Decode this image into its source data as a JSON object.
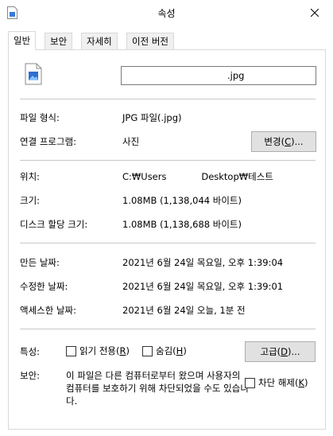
{
  "window": {
    "title": "속성"
  },
  "tabs": [
    {
      "label": "일반"
    },
    {
      "label": "보안"
    },
    {
      "label": "자세히"
    },
    {
      "label": "이전 버전"
    }
  ],
  "file": {
    "name": ".jpg"
  },
  "general": {
    "file_type_label": "파일 형식:",
    "file_type_value": "JPG 파일(.jpg)",
    "opens_with_label": "연결 프로그램:",
    "opens_with_value": "사진",
    "change_button": "변경(",
    "change_button_key": "C",
    "change_button_tail": ")...",
    "location_label": "위치:",
    "location_value": "C:₩Users            Desktop₩테스트",
    "size_label": "크기:",
    "size_value": "1.08MB (1,138,044 바이트)",
    "disk_size_label": "디스크 할당 크기:",
    "disk_size_value": "1.08MB (1,138,688 바이트)",
    "created_label": "만든 날짜:",
    "created_value": "2021년 6월 24일 목요일, 오후 1:39:04",
    "modified_label": "수정한 날짜:",
    "modified_value": "2021년 6월 24일 목요일, 오후 1:39:01",
    "accessed_label": "액세스한 날짜:",
    "accessed_value": "2021년 6월 24일 오늘, 1분 전"
  },
  "attributes": {
    "label": "특성:",
    "readonly": "읽기 전용(",
    "readonly_key": "R",
    "readonly_tail": ")",
    "hidden": "숨김(",
    "hidden_key": "H",
    "hidden_tail": ")",
    "advanced_button": "고급(",
    "advanced_key": "D",
    "advanced_tail": ")..."
  },
  "security": {
    "label": "보안:",
    "text": "이 파일은 다른 컴퓨터로부터 왔으며 사용자의 컴퓨터를 보호하기 위해 차단되었을 수도 있습니다.",
    "unblock": "차단 해제(",
    "unblock_key": "K",
    "unblock_tail": ")"
  }
}
